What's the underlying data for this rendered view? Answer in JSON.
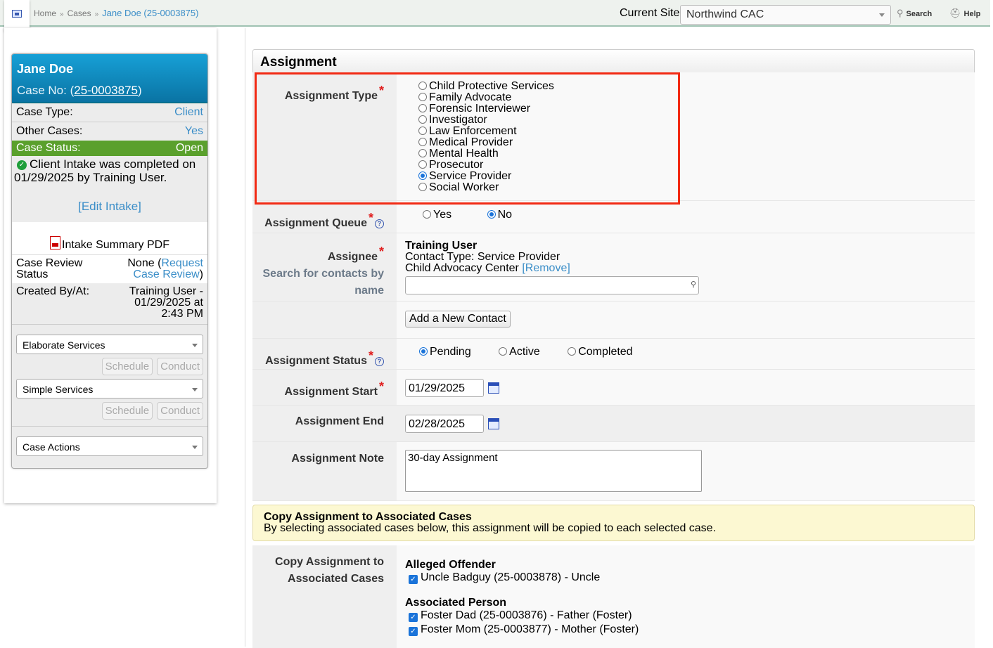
{
  "topbar": {
    "breadcrumbs": [
      "Home",
      "Cases",
      "Jane Doe (25-0003875)"
    ],
    "current_site_label": "Current Site",
    "current_site_value": "Northwind CAC",
    "search_label": "Search",
    "help_label": "Help"
  },
  "case_card": {
    "name": "Jane Doe",
    "case_no_prefix": "Case No: (",
    "case_no": "25-0003875",
    "case_no_suffix": ")",
    "case_type_label": "Case Type:",
    "case_type_value": "Client",
    "other_cases_label": "Other Cases:",
    "other_cases_value": "Yes",
    "case_status_label": "Case Status:",
    "case_status_value": "Open",
    "intake_text": "Client Intake was completed on 01/29/2025 by Training User.",
    "edit_intake": "[Edit Intake]",
    "intake_pdf": "Intake Summary PDF",
    "review_label": "Case Review Status",
    "review_value": "None (",
    "review_link": "Request Case Review",
    "review_suffix": ")",
    "created_label": "Created By/At:",
    "created_value": "Training User - 01/29/2025 at 2:43 PM",
    "elaborate_services": "Elaborate Services",
    "simple_services": "Simple Services",
    "case_actions": "Case Actions",
    "schedule_label": "Schedule",
    "conduct_label": "Conduct"
  },
  "form": {
    "title": "Assignment",
    "assignment_type_label": "Assignment Type",
    "assignment_types": [
      "Child Protective Services",
      "Family Advocate",
      "Forensic Interviewer",
      "Investigator",
      "Law Enforcement",
      "Medical Provider",
      "Mental Health",
      "Prosecutor",
      "Service Provider",
      "Social Worker"
    ],
    "assignment_type_selected": "Service Provider",
    "queue_label": "Assignment Queue",
    "queue_yes": "Yes",
    "queue_no": "No",
    "queue_selected": "No",
    "assignee_label": "Assignee",
    "assignee_help": "Search for contacts by name",
    "assignee_name": "Training User",
    "assignee_contact_type": "Contact Type: Service Provider",
    "assignee_org": "Child Advocacy Center",
    "remove_link": "[Remove]",
    "search_placeholder": "",
    "add_contact": "Add a New Contact",
    "status_label": "Assignment Status",
    "status_options": [
      "Pending",
      "Active",
      "Completed"
    ],
    "status_selected": "Pending",
    "start_label": "Assignment Start",
    "start_value": "01/29/2025",
    "end_label": "Assignment End",
    "end_value": "02/28/2025",
    "note_label": "Assignment Note",
    "note_value": "30-day Assignment",
    "copy_title": "Copy Assignment to Associated Cases",
    "copy_desc": "By selecting associated cases below, this assignment will be copied to each selected case.",
    "copy_label": "Copy Assignment to Associated Cases",
    "offender_heading": "Alleged Offender",
    "offender_items": [
      "Uncle Badguy (25-0003878) - Uncle"
    ],
    "person_heading": "Associated Person",
    "person_items": [
      "Foster Dad (25-0003876) - Father (Foster)",
      "Foster Mom (25-0003877) - Mother (Foster)"
    ]
  }
}
